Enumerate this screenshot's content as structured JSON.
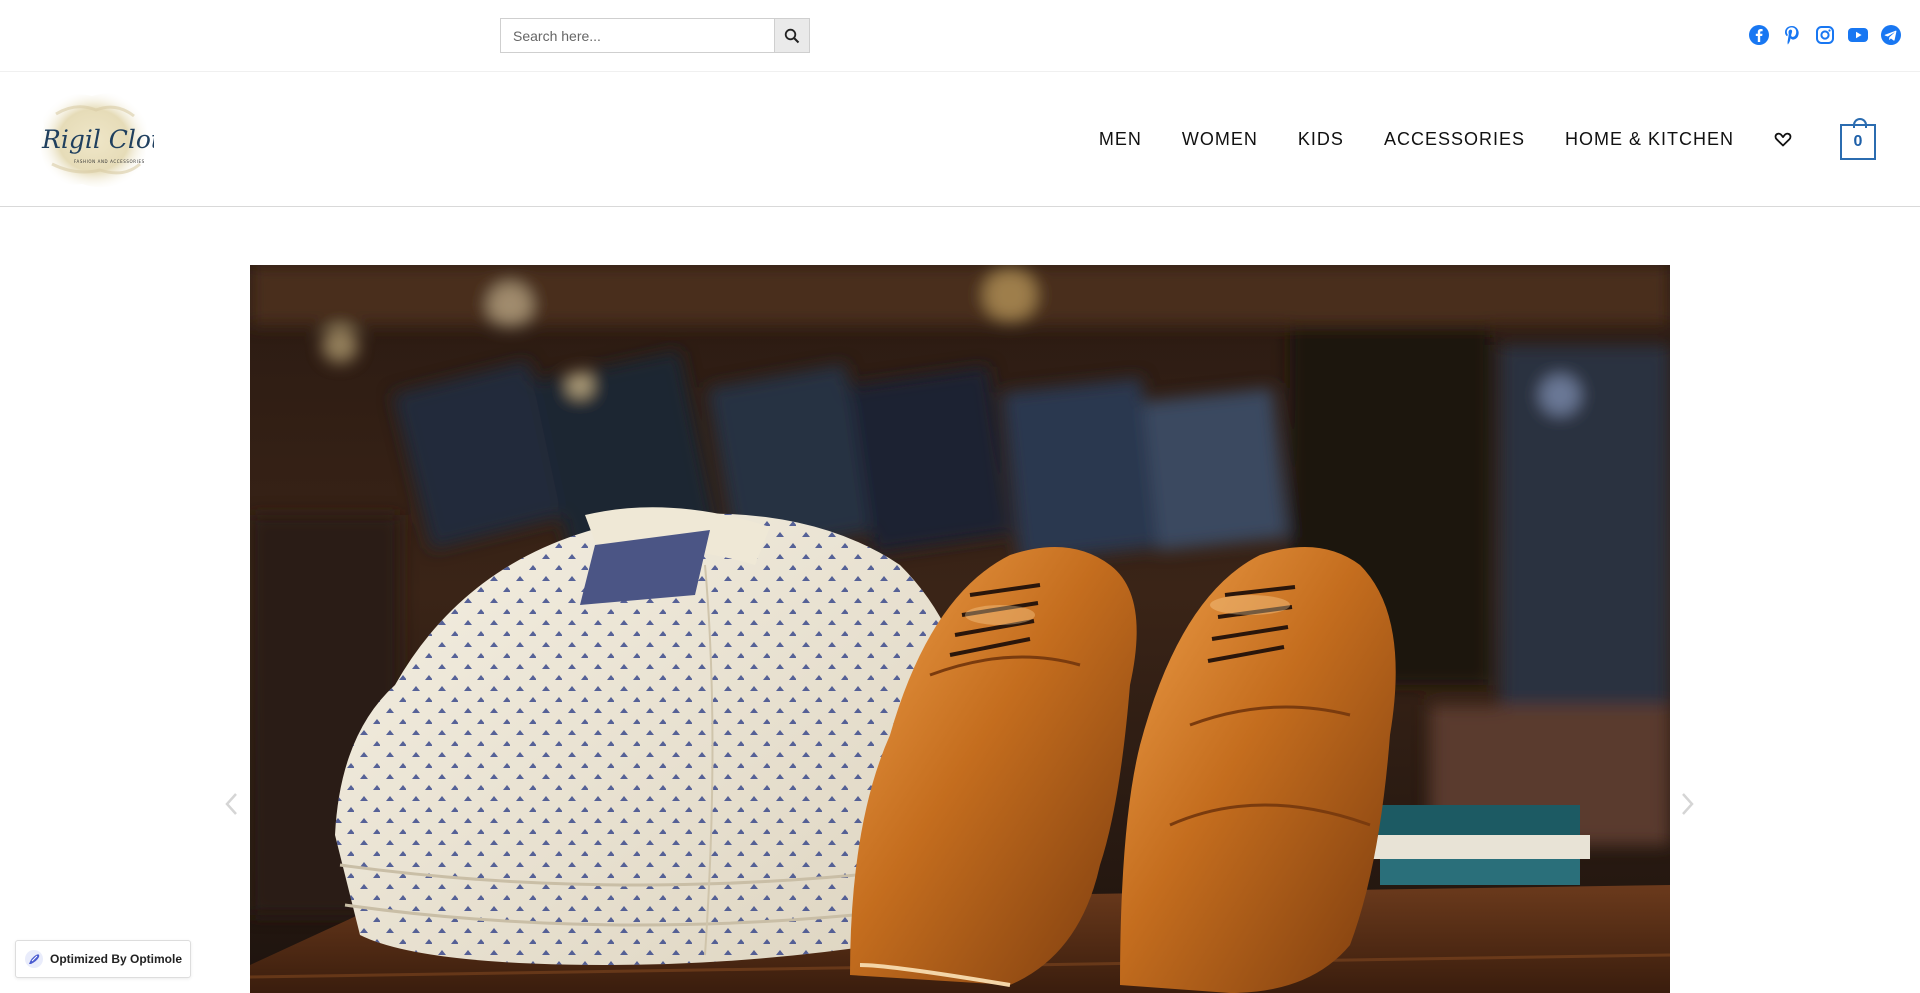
{
  "search": {
    "placeholder": "Search here..."
  },
  "social": [
    "facebook-icon",
    "pinterest-icon",
    "instagram-icon",
    "youtube-icon",
    "telegram-icon"
  ],
  "brand_color": "#1877f2",
  "logo": {
    "text": "Rigil Clothing",
    "tagline": "FASHION AND ACCESSORIES"
  },
  "nav": {
    "items": [
      "MEN",
      "WOMEN",
      "KIDS",
      "ACCESSORIES",
      "HOME & KITCHEN"
    ]
  },
  "cart": {
    "count": "0"
  },
  "badge": {
    "label": "Optimized By Optimole"
  }
}
